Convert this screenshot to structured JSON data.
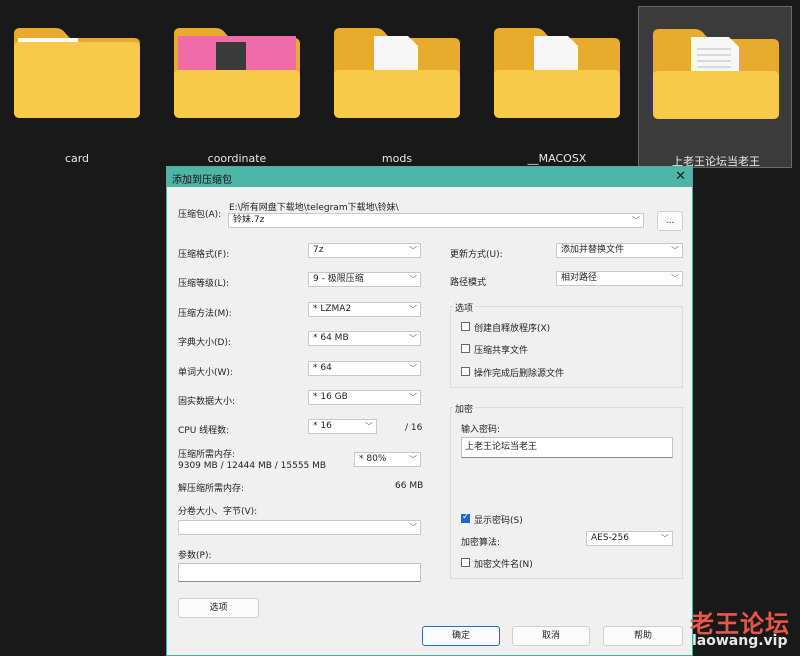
{
  "folders": [
    {
      "name": "card",
      "type": "plain"
    },
    {
      "name": "coordinate",
      "type": "image"
    },
    {
      "name": "mods",
      "type": "file"
    },
    {
      "name": "__MACOSX",
      "type": "file"
    },
    {
      "name": "上老王论坛当老王",
      "type": "text",
      "selected": true
    }
  ],
  "dialog": {
    "title": "添加到压缩包",
    "close": "✕",
    "archive_label": "压缩包(A):",
    "archive_path": "E:\\所有网盘下载地\\telegram下载地\\铃妹\\",
    "archive_name": "铃妹.7z",
    "browse": "...",
    "format_label": "压缩格式(F):",
    "format_value": "7z",
    "level_label": "压缩等级(L):",
    "level_value": "9 - 极限压缩",
    "method_label": "压缩方法(M):",
    "method_value": "* LZMA2",
    "dict_label": "字典大小(D):",
    "dict_value": "* 64 MB",
    "word_label": "单词大小(W):",
    "word_value": "* 64",
    "solid_label": "固实数据大小:",
    "solid_value": "* 16 GB",
    "cpu_label": "CPU 线程数:",
    "cpu_value": "* 16",
    "cpu_total": "/ 16",
    "mem_label": "压缩所需内存:",
    "mem_value": "9309 MB / 12444 MB / 15555 MB",
    "mem_pct": "* 80%",
    "demem_label": "解压缩所需内存:",
    "demem_value": "66 MB",
    "split_label": "分卷大小、字节(V):",
    "params_label": "参数(P):",
    "options_btn": "选项",
    "update_label": "更新方式(U):",
    "update_value": "添加并替换文件",
    "pathmode_label": "路径模式",
    "pathmode_value": "相对路径",
    "opts_group": "选项",
    "opt_sfx": "创建自释放程序(X)",
    "opt_shared": "压缩共享文件",
    "opt_delete": "操作完成后删除源文件",
    "enc_group": "加密",
    "pw_label": "输入密码:",
    "pw_value": "上老王论坛当老王",
    "show_pw": "显示密码(S)",
    "enc_method_label": "加密算法:",
    "enc_method_value": "AES-256",
    "enc_names": "加密文件名(N)",
    "ok": "确定",
    "cancel": "取消",
    "help": "帮助"
  },
  "watermark": {
    "line1": "老王论坛",
    "line2": "laowang.vip"
  },
  "colors": {
    "titlebar": "#4fb5a6",
    "folder": "#f8c94a",
    "checked": "#1e66c8",
    "watermark": "#e8574a"
  }
}
